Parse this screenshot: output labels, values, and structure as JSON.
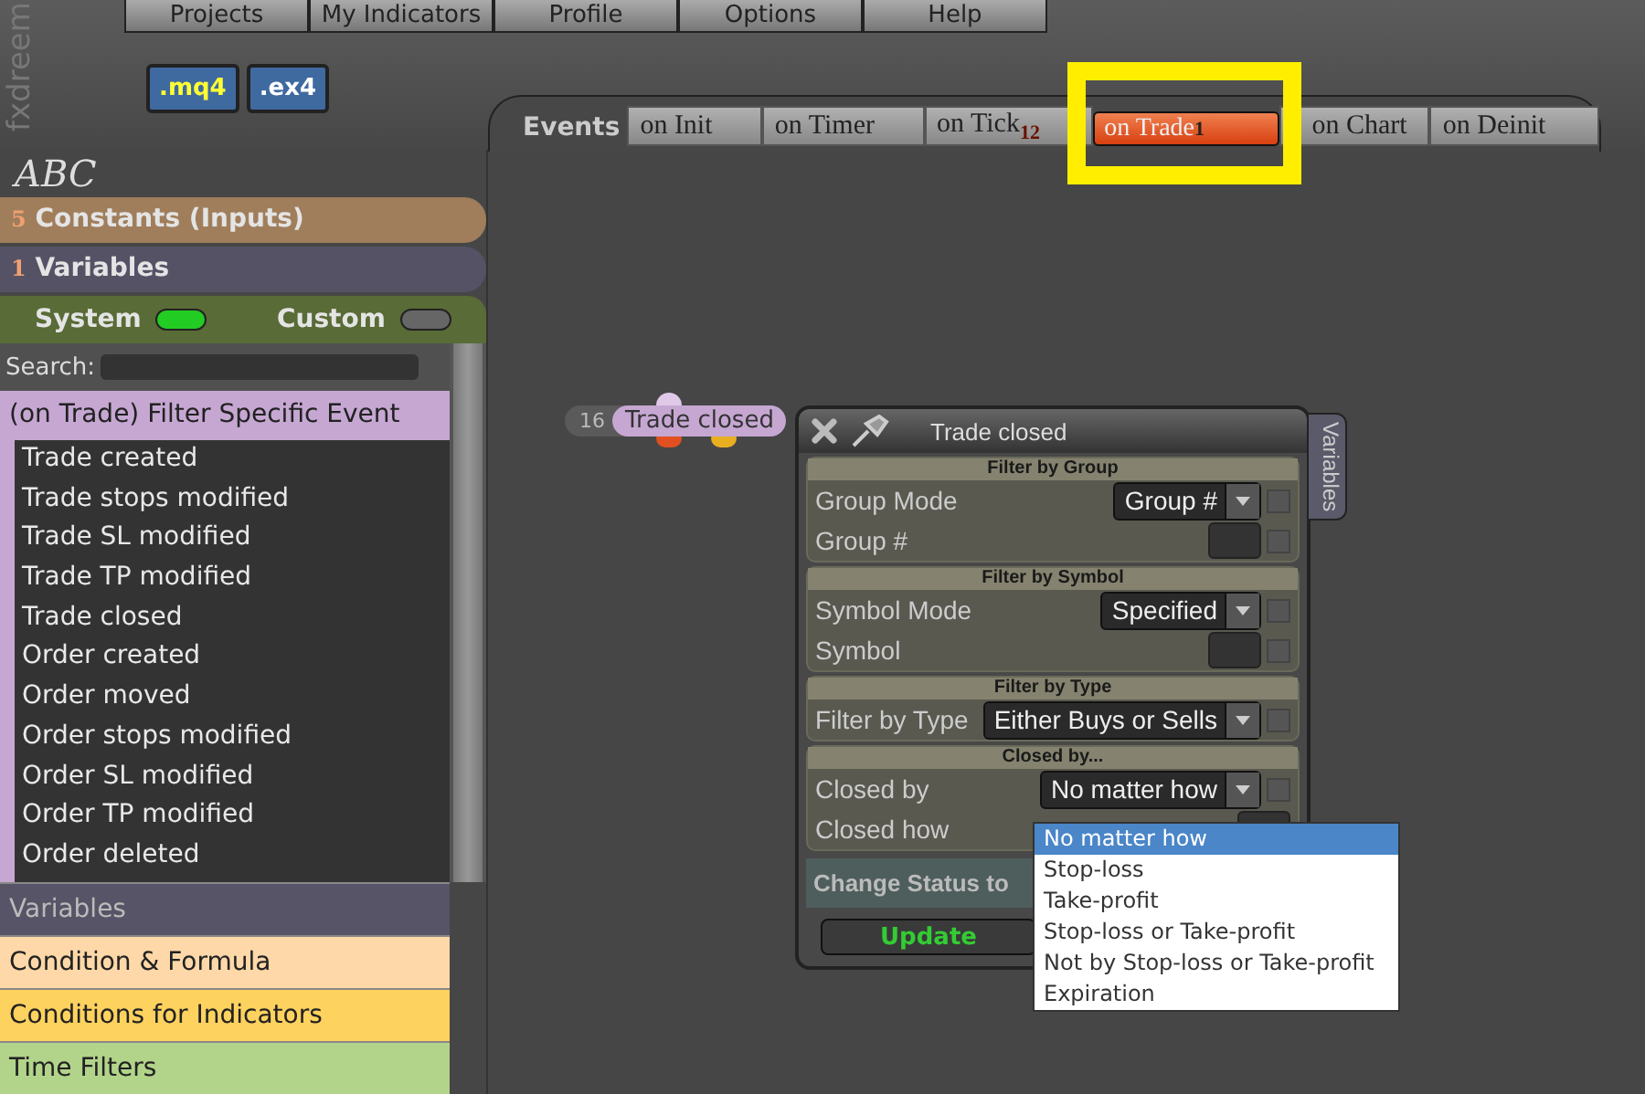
{
  "logo": "fxdreem",
  "menu": [
    "Projects",
    "My Indicators",
    "Profile",
    "Options",
    "Help"
  ],
  "file_buttons": [
    ".mq4",
    ".ex4"
  ],
  "tabs_label": "Events",
  "tabs": [
    {
      "label": "on Init",
      "selected": false
    },
    {
      "label": "on Timer",
      "selected": false
    },
    {
      "label": "on Tick",
      "count": "12",
      "selected": false
    },
    {
      "label": "on Trade",
      "count": "1",
      "selected": true
    },
    {
      "label": "on Chart",
      "selected": false
    },
    {
      "label": "on Deinit",
      "selected": false
    }
  ],
  "sidebar": {
    "abc": "ABC",
    "constants": {
      "count": "5",
      "label": "Constants (Inputs)"
    },
    "variables": {
      "count": "1",
      "label": "Variables"
    },
    "toggles": [
      {
        "label": "System",
        "on": true
      },
      {
        "label": "Custom",
        "on": false
      }
    ],
    "search": {
      "label": "Search:"
    },
    "group": {
      "title": "(on Trade) Filter Specific Event",
      "items": [
        "Trade created",
        "Trade stops modified",
        "Trade SL modified",
        "Trade TP modified",
        "Trade closed",
        "Order created",
        "Order moved",
        "Order stops modified",
        "Order SL modified",
        "Order TP modified",
        "Order deleted"
      ]
    },
    "sections": [
      {
        "label": "Variables",
        "color": "#565466"
      },
      {
        "label": "Condition & Formula",
        "color": "#fed8a8"
      },
      {
        "label": "Conditions for Indicators",
        "color": "#fed25e"
      },
      {
        "label": "Time Filters",
        "color": "#b2d48a"
      }
    ]
  },
  "node": {
    "number": "16",
    "label": "Trade closed"
  },
  "dialog": {
    "title": "Trade closed",
    "side_tab": "Variables",
    "sections": [
      {
        "title": "Filter by Group",
        "rows": [
          {
            "label": "Group Mode",
            "kind": "select",
            "value": "Group #",
            "checked": false
          },
          {
            "label": "Group #",
            "kind": "input",
            "checked": false
          }
        ]
      },
      {
        "title": "Filter by Symbol",
        "rows": [
          {
            "label": "Symbol Mode",
            "kind": "select",
            "value": "Specified",
            "checked": false
          },
          {
            "label": "Symbol",
            "kind": "input",
            "checked": false
          }
        ]
      },
      {
        "title": "Filter by Type",
        "rows": [
          {
            "label": "Filter by Type",
            "kind": "select",
            "value": "Either Buys or Sells",
            "checked": false
          }
        ]
      },
      {
        "title": "Closed by...",
        "rows": [
          {
            "label": "Closed by",
            "kind": "select",
            "value": "No matter how",
            "checked": false
          },
          {
            "label": "Closed how",
            "kind": "input"
          }
        ]
      }
    ],
    "change_status": "Change Status to",
    "update": "Update"
  },
  "dropdown": {
    "options": [
      {
        "label": "No matter how",
        "selected": true
      },
      {
        "label": "Stop-loss",
        "selected": false
      },
      {
        "label": "Take-profit",
        "selected": false
      },
      {
        "label": "Stop-loss or Take-profit",
        "selected": false
      },
      {
        "label": "Not by Stop-loss or Take-profit",
        "selected": false
      },
      {
        "label": "Expiration",
        "selected": false
      }
    ]
  }
}
